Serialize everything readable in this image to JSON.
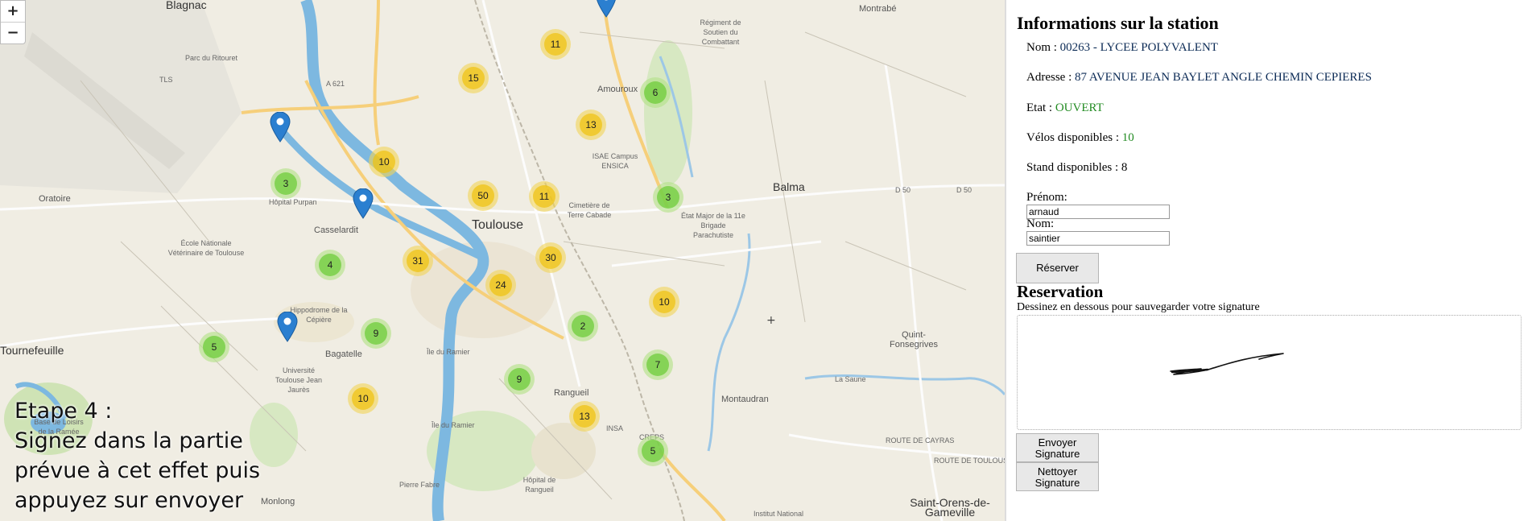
{
  "map": {
    "zoom_in_label": "+",
    "zoom_out_label": "−",
    "places": {
      "blagnac": "Blagnac",
      "montrabe": "Montrabé",
      "regiment": "Régiment de Soutien du Combattant",
      "parc_ritouret": "Parc du Ritouret",
      "tls": "TLS",
      "amouroux": "Amouroux",
      "isae": "ISAE Campus ENSICA",
      "a621": "A 621",
      "oratoire": "Oratoire",
      "hopital_purpan": "Hôpital Purpan",
      "casselardit": "Casselardit",
      "toulouse": "Toulouse",
      "cimetiere": "Cimetière de Terre Cabade",
      "etat_major": "État Major de la 11e Brigade Parachutiste",
      "balma": "Balma",
      "d50a": "D 50",
      "d50b": "D 50",
      "ecole_vet": "École Nationale Vétérinaire de Toulouse",
      "hippodrome": "Hippodrome de la Cépière",
      "tournefeuille": "Tournefeuille",
      "bagatelle": "Bagatelle",
      "ile_ramier": "Île du Ramier",
      "ile_ramier2": "Île du Ramier",
      "universite": "Université Toulouse Jean Jaurès",
      "quint": "Quint-Fonsegrives",
      "la_saune": "La Saune",
      "rangueil": "Rangueil",
      "montaudran": "Montaudran",
      "insa": "INSA",
      "creps": "CREPS",
      "base_loisirs": "Base de Loisirs de la Ramée",
      "pierre_fabre": "Pierre Fabre",
      "monlong": "Monlong",
      "hopital_rangueil": "Hôpital de Rangueil",
      "saint_orens": "Saint-Orens-de-Gameville",
      "institut": "Institut National",
      "route_cayras": "ROUTE DE CAYRAS",
      "route_toulouse": "ROUTE DE TOULOUSE"
    },
    "clusters": [
      {
        "count": "11",
        "color": "yellow"
      },
      {
        "count": "15",
        "color": "yellow"
      },
      {
        "count": "6",
        "color": "green"
      },
      {
        "count": "13",
        "color": "yellow"
      },
      {
        "count": "10",
        "color": "yellow"
      },
      {
        "count": "3",
        "color": "green"
      },
      {
        "count": "50",
        "color": "yellow"
      },
      {
        "count": "11",
        "color": "yellow"
      },
      {
        "count": "3",
        "color": "green"
      },
      {
        "count": "4",
        "color": "green"
      },
      {
        "count": "31",
        "color": "yellow"
      },
      {
        "count": "30",
        "color": "yellow"
      },
      {
        "count": "24",
        "color": "yellow"
      },
      {
        "count": "10",
        "color": "yellow"
      },
      {
        "count": "2",
        "color": "green"
      },
      {
        "count": "9",
        "color": "green"
      },
      {
        "count": "5",
        "color": "green"
      },
      {
        "count": "7",
        "color": "green"
      },
      {
        "count": "9",
        "color": "green"
      },
      {
        "count": "10",
        "color": "yellow"
      },
      {
        "count": "13",
        "color": "yellow"
      },
      {
        "count": "5",
        "color": "green"
      }
    ],
    "caption": {
      "line1": "Etape 4 :",
      "line2": "Signez dans la partie",
      "line3": "prévue à cet effet puis",
      "line4": "appuyez sur envoyer"
    }
  },
  "panel": {
    "title": "Informations sur la station",
    "nom_label": "Nom : ",
    "nom_value": "00263 - LYCEE POLYVALENT",
    "adresse_label": "Adresse : ",
    "adresse_value": "87 AVENUE JEAN BAYLET ANGLE CHEMIN CEPIERES",
    "etat_label": "Etat : ",
    "etat_value": "OUVERT",
    "velos_label": "Vélos disponibles : ",
    "velos_value": "10",
    "stands_label": "Stand disponibles : ",
    "stands_value": "8",
    "prenom_label": "Prénom:",
    "prenom_value": "arnaud",
    "nomfield_label": "Nom:",
    "nomfield_value": "saintier",
    "reserver_button": "Réserver",
    "reservation_title": "Reservation",
    "signature_hint": "Dessinez en dessous pour sauvegarder votre signature",
    "send_button_line1": "Envoyer",
    "send_button_line2": "Signature",
    "clear_button_line1": "Nettoyer",
    "clear_button_line2": "Signature"
  },
  "colors": {
    "cluster_green": "#6ecc39",
    "cluster_yellow": "#f0c20c",
    "pin_blue": "#2b7fd0",
    "status_green": "#228b22",
    "river": "#7db8e0"
  }
}
